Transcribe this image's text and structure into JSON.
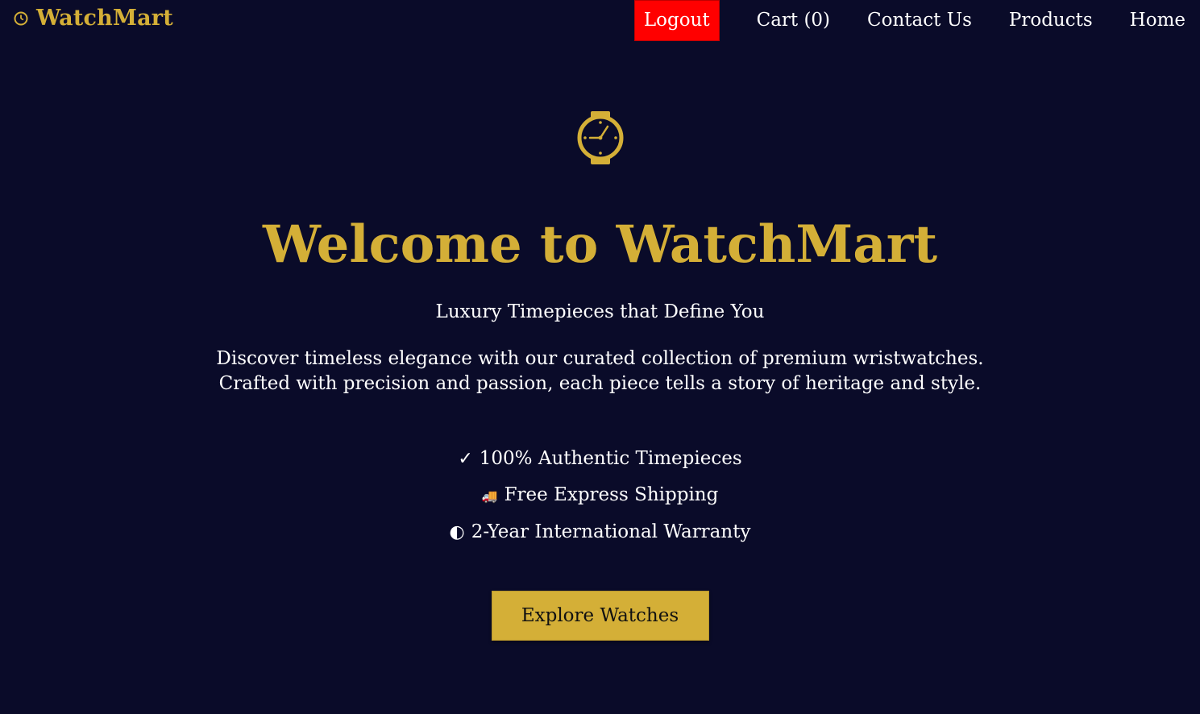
{
  "brand": {
    "name": "WatchMart",
    "icon": "watch-icon",
    "color": "#d4af37"
  },
  "nav": {
    "logout": "Logout",
    "cart": "Cart (0)",
    "contact": "Contact Us",
    "products": "Products",
    "home": "Home",
    "logout_color": "#ff0000"
  },
  "hero": {
    "icon": "watch-icon",
    "title": "Welcome to WatchMart",
    "tagline": "Luxury Timepieces that Define You",
    "description": "Discover timeless elegance with our curated collection of premium wristwatches. Crafted with precision and passion, each piece tells a story of heritage and style.",
    "features": [
      {
        "icon": "checkmark-icon",
        "glyph": "✓",
        "label": "100% Authentic Timepieces"
      },
      {
        "icon": "truck-icon",
        "glyph": "🚚",
        "label": "Free Express Shipping"
      },
      {
        "icon": "shield-icon",
        "glyph": "◐",
        "label": "2-Year International Warranty"
      }
    ],
    "cta_label": "Explore Watches",
    "accent": "#d4af37",
    "background": "#0a0b29"
  }
}
